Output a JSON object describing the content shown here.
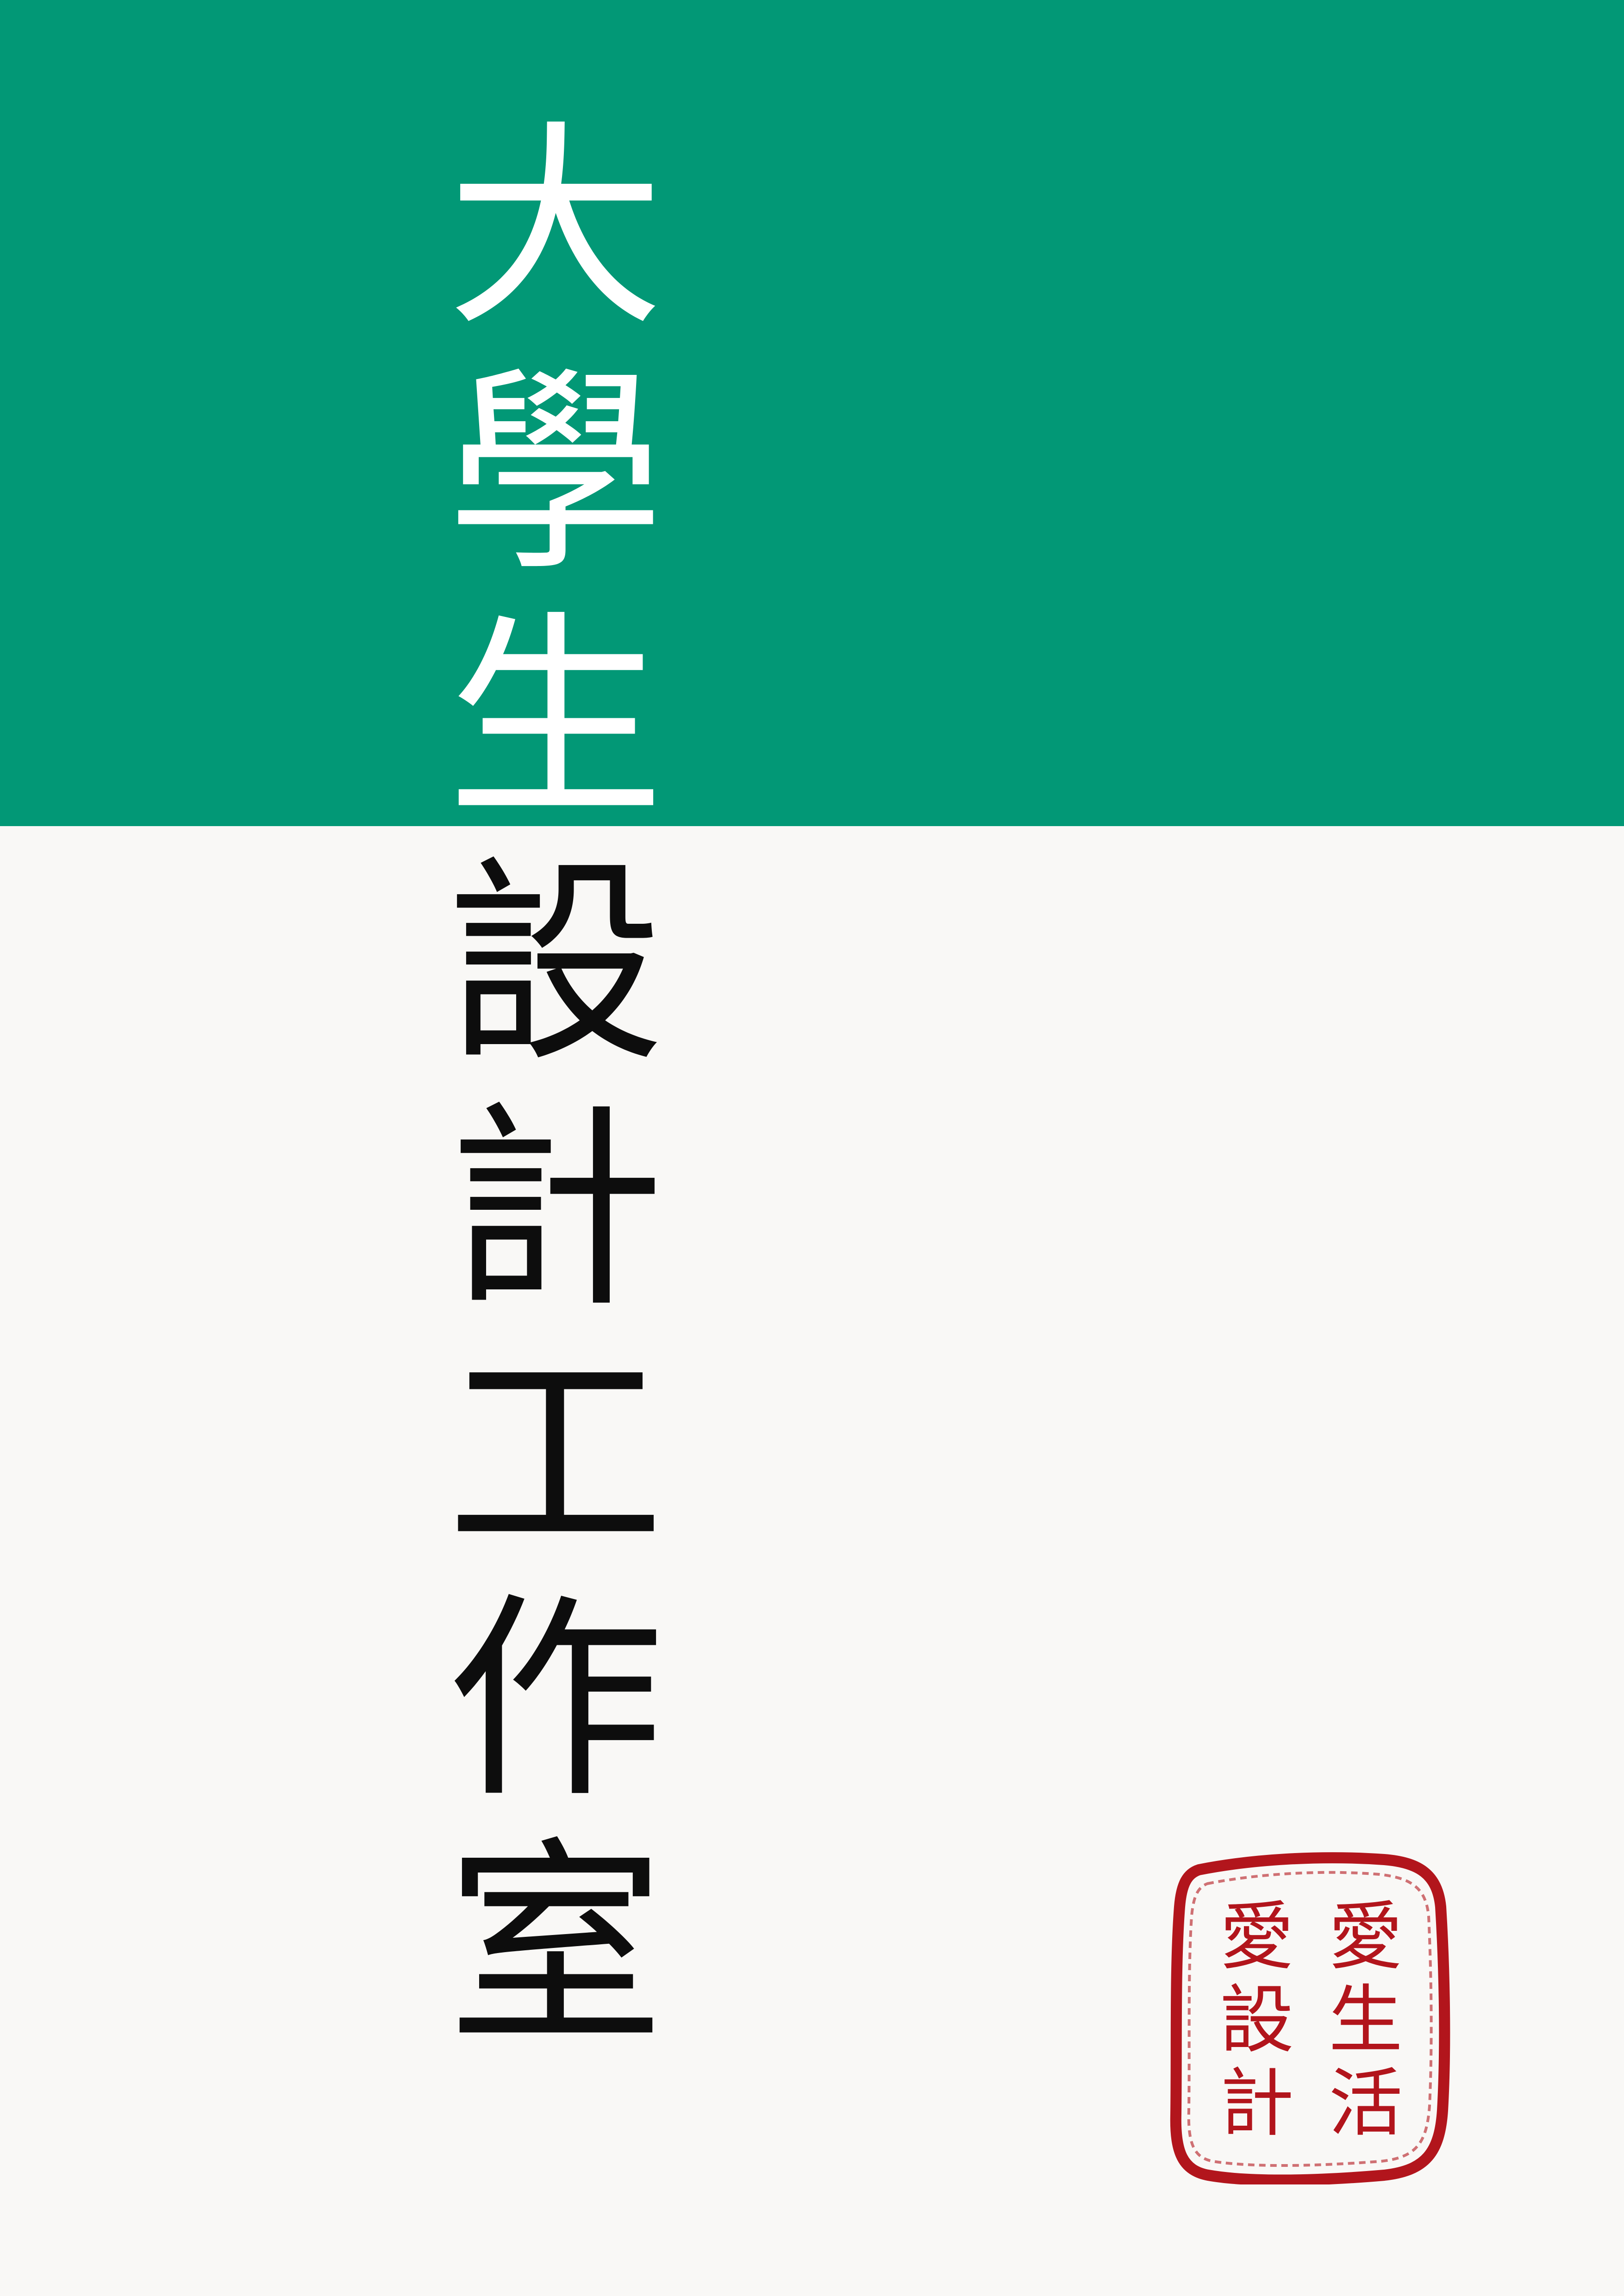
{
  "colors": {
    "band": "#029876",
    "background": "#f9f8f6",
    "title_on_band": "#ffffff",
    "title_on_background": "#0d0d0d",
    "seal": "#b2151c"
  },
  "title": {
    "text": "大學生設計工作室",
    "chars": [
      "大",
      "學",
      "生",
      "設",
      "計",
      "工",
      "作",
      "室"
    ]
  },
  "seal": {
    "text": "愛生活愛設計",
    "right_column": [
      "愛",
      "生",
      "活"
    ],
    "left_column": [
      "愛",
      "設",
      "計"
    ]
  }
}
